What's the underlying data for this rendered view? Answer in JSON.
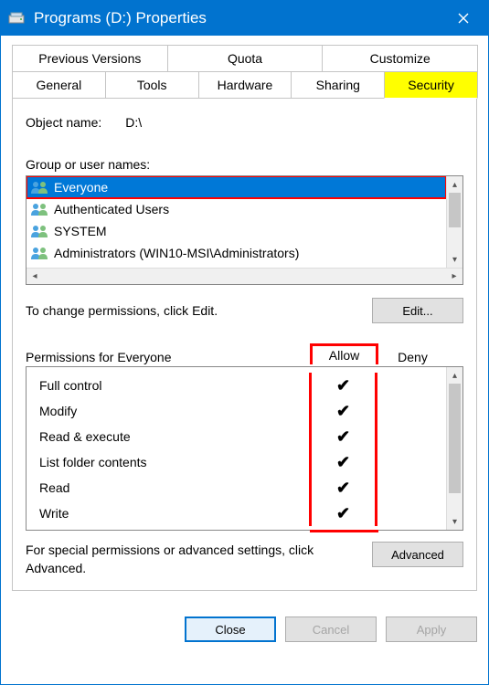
{
  "window": {
    "title": "Programs (D:) Properties"
  },
  "tabs": {
    "row1": [
      "Previous Versions",
      "Quota",
      "Customize"
    ],
    "row2": [
      "General",
      "Tools",
      "Hardware",
      "Sharing",
      "Security"
    ],
    "active": "Security"
  },
  "object_name": {
    "label": "Object name:",
    "value": "D:\\"
  },
  "group_label": "Group or user names:",
  "groups": [
    {
      "name": "Everyone",
      "selected": true
    },
    {
      "name": "Authenticated Users",
      "selected": false
    },
    {
      "name": "SYSTEM",
      "selected": false
    },
    {
      "name": "Administrators (WIN10-MSI\\Administrators)",
      "selected": false
    }
  ],
  "edit_hint": "To change permissions, click Edit.",
  "edit_button": "Edit...",
  "permissions_header": {
    "label": "Permissions for Everyone",
    "allow": "Allow",
    "deny": "Deny"
  },
  "permissions": [
    {
      "name": "Full control",
      "allow": true,
      "deny": false
    },
    {
      "name": "Modify",
      "allow": true,
      "deny": false
    },
    {
      "name": "Read & execute",
      "allow": true,
      "deny": false
    },
    {
      "name": "List folder contents",
      "allow": true,
      "deny": false
    },
    {
      "name": "Read",
      "allow": true,
      "deny": false
    },
    {
      "name": "Write",
      "allow": true,
      "deny": false
    }
  ],
  "advanced_hint": "For special permissions or advanced settings, click Advanced.",
  "advanced_button": "Advanced",
  "buttons": {
    "close": "Close",
    "cancel": "Cancel",
    "apply": "Apply"
  }
}
